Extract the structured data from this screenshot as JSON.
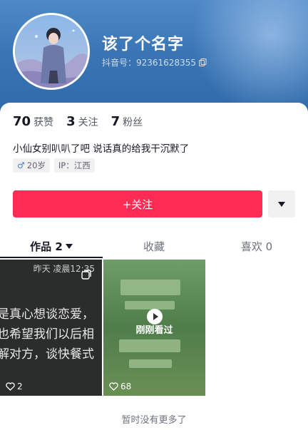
{
  "profile": {
    "nickname": "该了个名字",
    "douyin_id": "抖音号：92361628355",
    "bio": "小仙女别叭叭了吧 说话真的给我干沉默了",
    "tags": [
      {
        "icon": "male-gender-icon",
        "label": "20岁"
      },
      {
        "label": "IP：江西"
      }
    ]
  },
  "stats": [
    {
      "num": "70",
      "label": "获赞"
    },
    {
      "num": "3",
      "label": "关注"
    },
    {
      "num": "7",
      "label": "粉丝"
    }
  ],
  "actions": {
    "follow_label": "+关注",
    "more_icon": "caret-down-icon"
  },
  "tabs": [
    {
      "label": "作品 2",
      "active": true
    },
    {
      "label": "收藏"
    },
    {
      "label": "喜欢 0"
    }
  ],
  "videos": [
    {
      "header": "昨天 凌晨12:35",
      "lines": [
        "是真心想谈恋爱，",
        "也希望我们以后相",
        "解对方，谈快餐式"
      ],
      "likes": "2"
    },
    {
      "overlay": "刚刚看过",
      "likes": "68"
    }
  ],
  "footer": "暂时没有更多了",
  "colors": {
    "accent": "#fe2c55",
    "header": "#3a76b6"
  }
}
